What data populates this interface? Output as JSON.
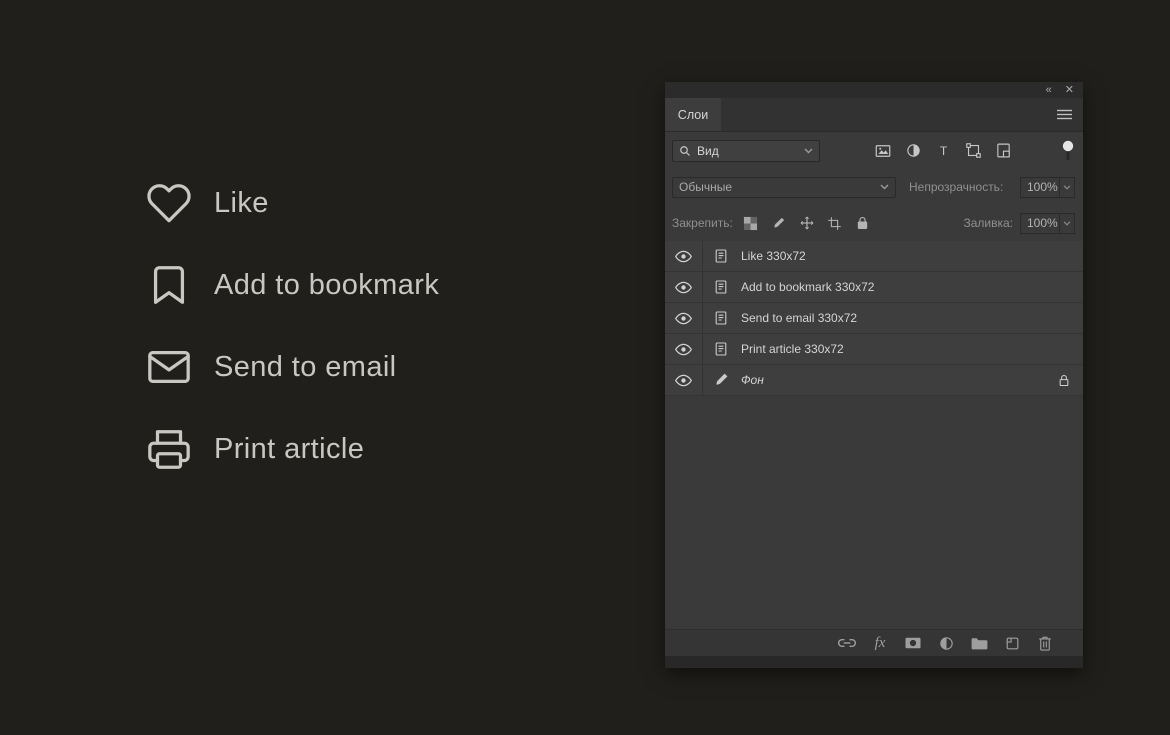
{
  "colors": {
    "background": "#211f1b",
    "panel_bg": "#3a3a3a",
    "text": "#c9c7c1"
  },
  "artboard": {
    "items": [
      {
        "icon": "heart-icon",
        "label": "Like"
      },
      {
        "icon": "bookmark-icon",
        "label": "Add to bookmark"
      },
      {
        "icon": "mail-icon",
        "label": "Send to email"
      },
      {
        "icon": "printer-icon",
        "label": "Print article"
      }
    ]
  },
  "panel": {
    "window": {
      "collapse": "«",
      "close": "✕"
    },
    "tab": "Слои",
    "filter": {
      "search_value": "Вид"
    },
    "blend": {
      "value": "Обычные"
    },
    "opacity": {
      "label": "Непрозрачность:",
      "value": "100%"
    },
    "lock": {
      "label": "Закрепить:"
    },
    "fill": {
      "label": "Заливка:",
      "value": "100%"
    },
    "layers": [
      {
        "name": "Like 330x72"
      },
      {
        "name": "Add to bookmark 330x72"
      },
      {
        "name": "Send to email 330x72"
      },
      {
        "name": "Print article 330x72"
      },
      {
        "name": "Фон",
        "locked": true
      }
    ],
    "footer": {
      "fx_label": "fx"
    }
  }
}
